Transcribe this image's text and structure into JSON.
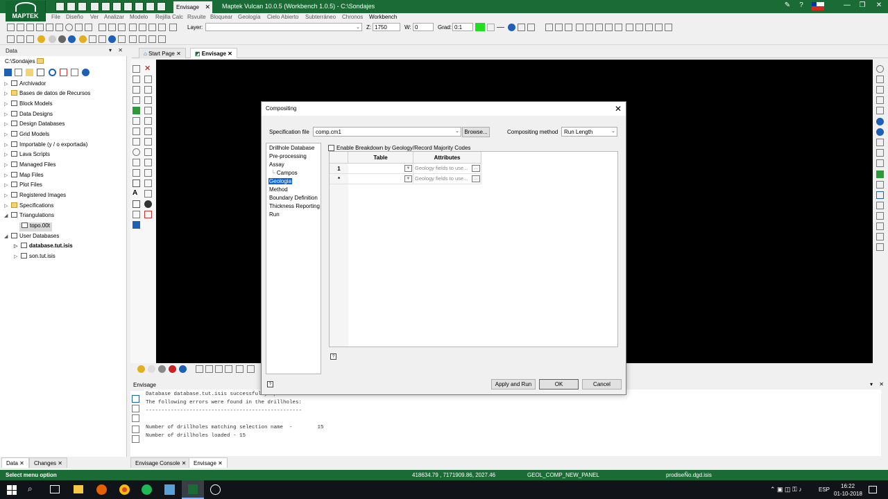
{
  "app": {
    "logo_text": "MAPTEK",
    "window_title": "Maptek Vulcan 10.0.5 (Workbench 1.0.5) - C:\\Sondajes",
    "top_tab": "Envisage",
    "menu": [
      "File",
      "Diseño",
      "Ver",
      "Analizar",
      "Modelo",
      "Rejilla Calc",
      "Rsvuite",
      "Bloquear",
      "Geología",
      "Cielo Abierto",
      "Subterráneo",
      "Chronos",
      "Workbench"
    ]
  },
  "toolbar": {
    "layer_label": "Layer:",
    "layer_value": "",
    "z_label": "Z:",
    "z_value": "1750",
    "w_label": "W:",
    "w_value": "0",
    "grad_label": "Grad:",
    "grad_value": "0:1"
  },
  "data_panel": {
    "title": "Data",
    "path": "C:\\Sondajes",
    "items": [
      {
        "label": "Archivador"
      },
      {
        "label": "Bases de datos de Recursos"
      },
      {
        "label": "Block Models"
      },
      {
        "label": "Data Designs"
      },
      {
        "label": "Design Databases"
      },
      {
        "label": "Grid Models"
      },
      {
        "label": "Importable (y / o exportada)"
      },
      {
        "label": "Lava Scripts"
      },
      {
        "label": "Managed Files"
      },
      {
        "label": "Map Files"
      },
      {
        "label": "Plot Files"
      },
      {
        "label": "Registered Images"
      },
      {
        "label": "Specifications"
      },
      {
        "label": "Triangulations"
      },
      {
        "label": "topo.00t"
      },
      {
        "label": "User Databases"
      },
      {
        "label": "database.tut.isis"
      },
      {
        "label": "son.tut.isis"
      }
    ],
    "bottom_tabs": [
      "Data",
      "Changes"
    ]
  },
  "doc_tabs": [
    "Start Page",
    "Envisage"
  ],
  "console": {
    "title": "Envisage",
    "lines": [
      "Database database.tut.isis successfully opened",
      "The following errors were found in the drillholes:",
      "",
      "--------------------------------------------------",
      "",
      "Number of drillholes matching selection name  -        15",
      "Number of drillholes loaded - 15"
    ],
    "tabs": [
      "Envisage Console",
      "Envisage"
    ]
  },
  "status": {
    "left": "Select menu option",
    "coords": "418634.79 , 7171909.86, 2027.46",
    "panel": "GEOL_COMP_NEW_PANEL",
    "file": "prodiseÑo.dgd.isis"
  },
  "taskbar": {
    "lang": "ESP",
    "time": "16:22",
    "date": "01-10-2018"
  },
  "dialog": {
    "title": "Compositing",
    "spec_label": "Specification file",
    "spec_value": "comp.cm1",
    "browse_label": "Browse...",
    "method_label": "Compositing method",
    "method_value": "Run Length",
    "nav": [
      {
        "label": "Drillhole Database"
      },
      {
        "label": "Pre-processing"
      },
      {
        "label": "Assay"
      },
      {
        "label": "Campos"
      },
      {
        "label": "Geologia"
      },
      {
        "label": "Method"
      },
      {
        "label": "Boundary Definition"
      },
      {
        "label": "Thickness Reporting"
      },
      {
        "label": "Run"
      }
    ],
    "checkbox_label": "Enable Breakdown by Geology/Record Majority Codes",
    "grid": {
      "headers": [
        "Table",
        "Attributes"
      ],
      "rows": [
        {
          "num": "1",
          "table": "",
          "attributes": "Geology fields to use..."
        },
        {
          "num": "*",
          "table": "",
          "attributes": "Geology fields to use..."
        }
      ]
    },
    "buttons": {
      "apply": "Apply and Run",
      "ok": "OK",
      "cancel": "Cancel"
    }
  }
}
